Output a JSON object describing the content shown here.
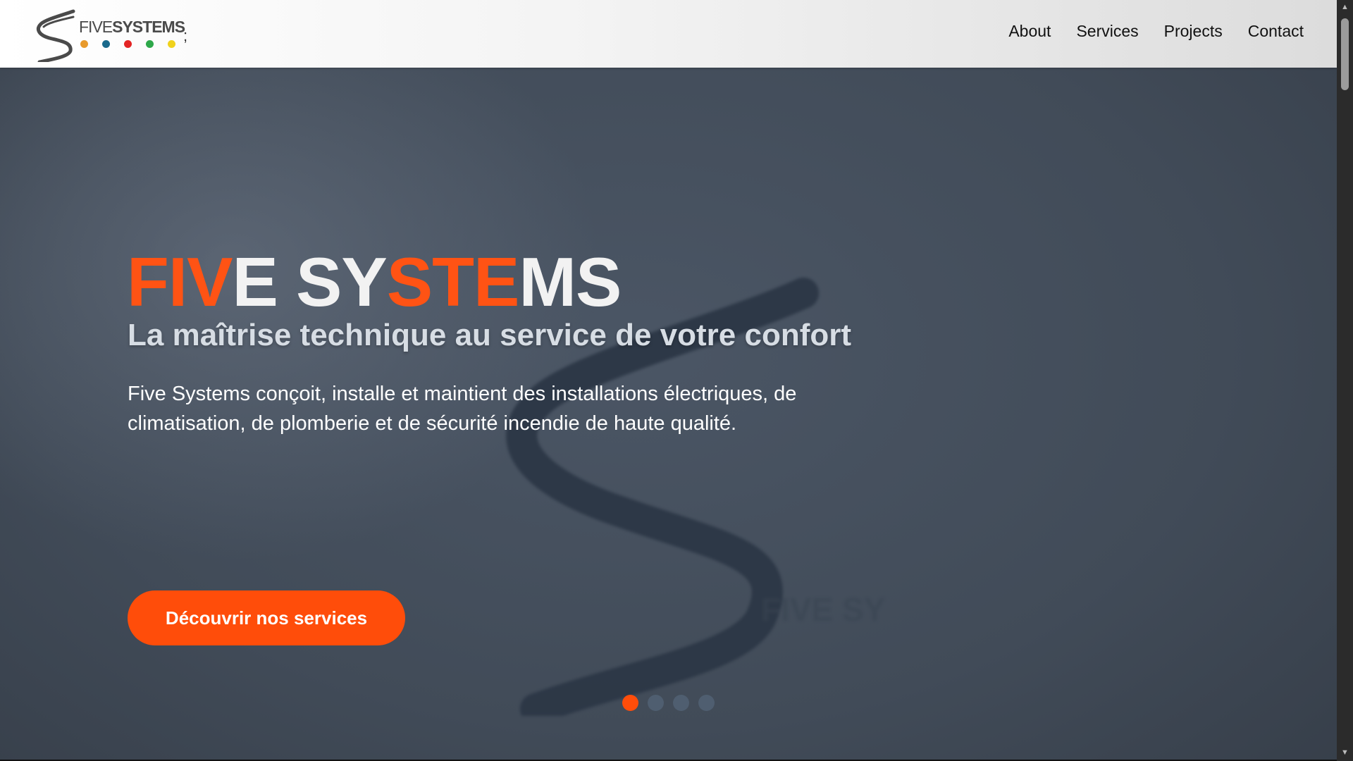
{
  "colors": {
    "accent": "#ff4d0a",
    "header_bg": "#f3f3f3",
    "hero_bg": "#47515e",
    "logo_dots": [
      "#e89a2c",
      "#1a6a8c",
      "#e32424",
      "#2ea84a",
      "#f0d21c"
    ]
  },
  "header": {
    "logo": {
      "text_light": "FIVE",
      "text_bold": "SYSTEMS",
      "icon": "five-systems-s-logo"
    },
    "stray_text": ";",
    "nav": [
      {
        "label": "About"
      },
      {
        "label": "Services"
      },
      {
        "label": "Projects"
      },
      {
        "label": "Contact"
      }
    ]
  },
  "hero": {
    "title_line": "FIVE SYSTEMS",
    "title_parts": [
      "FIV",
      "E SY",
      "STE",
      "MS"
    ],
    "subtitle": "La maîtrise technique au service de votre confort",
    "description": "Five Systems conçoit, installe et maintient des installations électriques, de climatisation, de plomberie et de sécurité incendie de haute qualité.",
    "cta_label": "Découvrir nos services",
    "carousel": {
      "count": 4,
      "active_index": 0
    }
  },
  "scrollbar": {
    "up_icon": "triangle-up",
    "down_icon": "triangle-down"
  }
}
